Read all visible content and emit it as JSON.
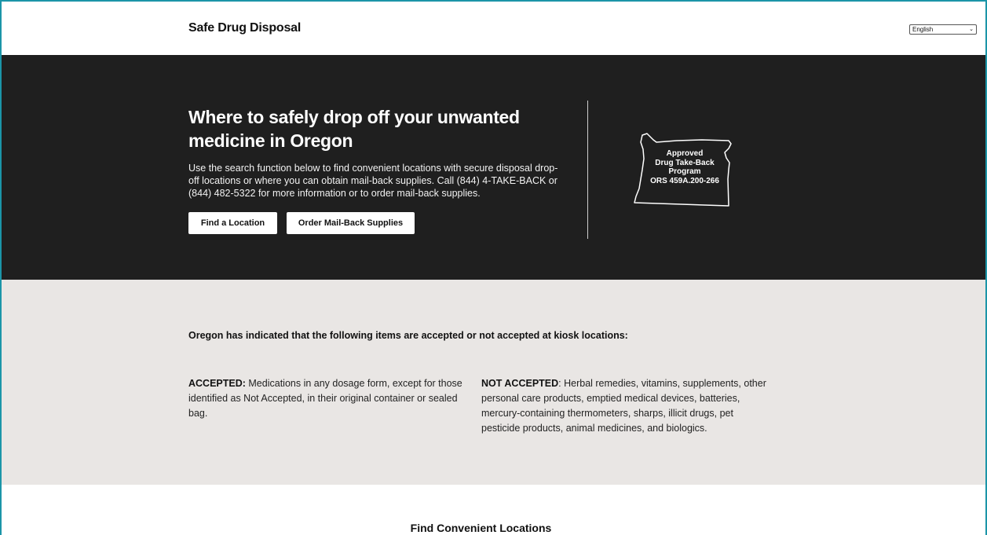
{
  "header": {
    "site_title": "Safe Drug Disposal",
    "language": "English"
  },
  "hero": {
    "title": "Where to safely drop off your unwanted medicine in Oregon",
    "intro": "Use the search function below to find convenient locations with secure disposal drop-off locations or where you can obtain mail-back supplies. Call (844) 4-TAKE-BACK or (844) 482-5322 for more information or to order mail-back supplies.",
    "find_button": "Find a Location",
    "order_button": "Order Mail-Back Supplies",
    "badge": {
      "line1": "Approved",
      "line2": "Drug Take-Back",
      "line3": "Program",
      "line4": "ORS 459A.200-266"
    }
  },
  "info": {
    "lead": "Oregon has indicated that the following items are accepted or not accepted at kiosk locations:",
    "accepted_label": "ACCEPTED:",
    "accepted_text": " Medications in any dosage form, except for those identified as Not Accepted, in their original container or sealed bag.",
    "not_accepted_label": "NOT ACCEPTED",
    "not_accepted_text": ": Herbal remedies, vitamins, supplements, other personal care products, emptied medical devices, batteries, mercury-containing thermometers, sharps, illicit drugs, pet pesticide products, animal medicines, and biologics."
  },
  "find": {
    "title": "Find Convenient Locations"
  },
  "colors": {
    "hero_bg": "#1f1f1f",
    "info_bg": "#e9e6e4",
    "frame": "#1b95a8"
  }
}
